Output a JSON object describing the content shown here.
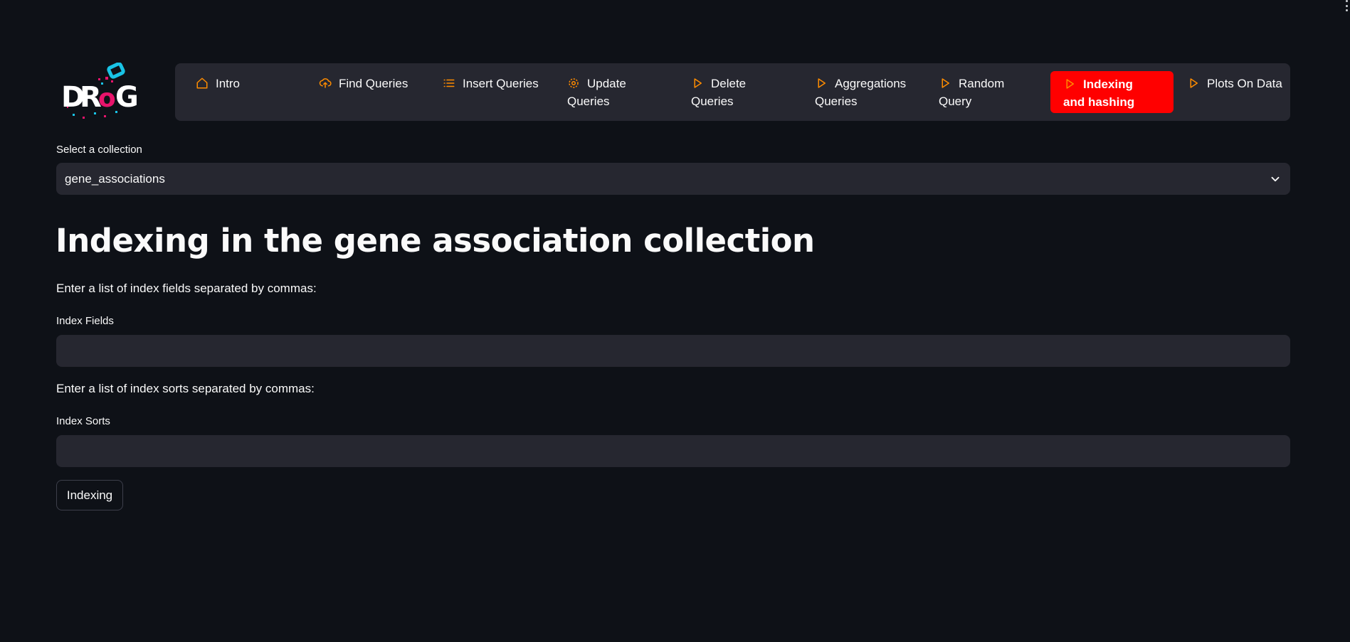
{
  "logo": {
    "text": "DRoG"
  },
  "nav": {
    "items": [
      {
        "label_line1": "Intro",
        "label_line2": "",
        "icon": "home-icon"
      },
      {
        "label_line1": "Find Queries",
        "label_line2": "",
        "icon": "cloud-upload-icon"
      },
      {
        "label_line1": "Insert Queries",
        "label_line2": "",
        "icon": "list-icon"
      },
      {
        "label_line1": "Update",
        "label_line2": "Queries",
        "icon": "gear-icon"
      },
      {
        "label_line1": "Delete",
        "label_line2": "Queries",
        "icon": "play-icon"
      },
      {
        "label_line1": "Aggregations",
        "label_line2": "Queries",
        "icon": "play-icon"
      },
      {
        "label_line1": "Random",
        "label_line2": "Query",
        "icon": "play-icon"
      },
      {
        "label_line1": "Indexing",
        "label_line2": "and hashing",
        "icon": "play-icon",
        "active": true
      },
      {
        "label_line1": "Plots On Data",
        "label_line2": "",
        "icon": "play-icon"
      }
    ],
    "icon_color": "#ff8c00",
    "active_bg": "#ff0000"
  },
  "collection": {
    "label": "Select a collection",
    "selected": "gene_associations"
  },
  "main": {
    "title": "Indexing in the gene association collection",
    "fields_prompt": "Enter a list of index fields separated by commas:",
    "fields_label": "Index Fields",
    "fields_value": "",
    "sorts_prompt": "Enter a list of index sorts separated by commas:",
    "sorts_label": "Index Sorts",
    "sorts_value": "",
    "button_label": "Indexing"
  },
  "colors": {
    "background": "#0e1117",
    "panel": "#262730",
    "text": "#fafafa"
  }
}
